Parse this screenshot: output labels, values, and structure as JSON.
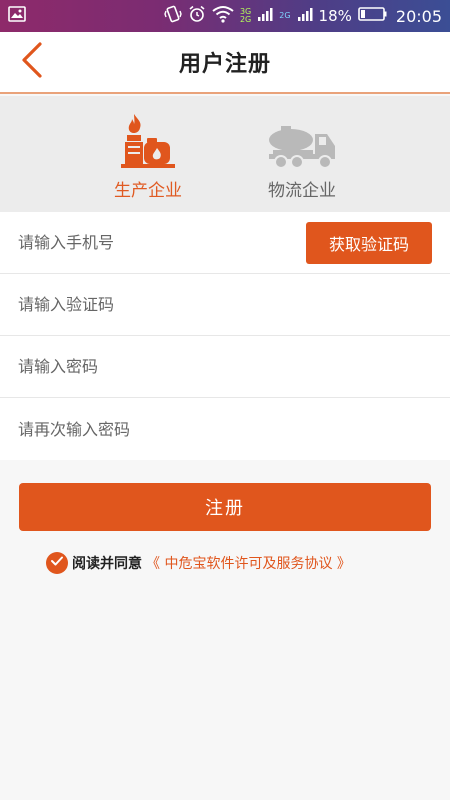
{
  "status_bar": {
    "network_top": "3G",
    "network_bottom": "2G",
    "network_secondary": "2G",
    "battery_percent": "18%",
    "time": "20:05"
  },
  "header": {
    "title": "用户注册"
  },
  "company_types": [
    {
      "label": "生产企业",
      "selected": true
    },
    {
      "label": "物流企业",
      "selected": false
    }
  ],
  "form": {
    "phone_placeholder": "请输入手机号",
    "get_code_label": "获取验证码",
    "code_placeholder": "请输入验证码",
    "password_placeholder": "请输入密码",
    "confirm_password_placeholder": "请再次输入密码"
  },
  "register_button_label": "注册",
  "agreement": {
    "checked": true,
    "text": "阅读并同意",
    "link": "《 中危宝软件许可及服务协议 》"
  },
  "colors": {
    "accent": "#e0561d",
    "header_border": "#e9a27a",
    "selector_bg": "#ececec"
  }
}
